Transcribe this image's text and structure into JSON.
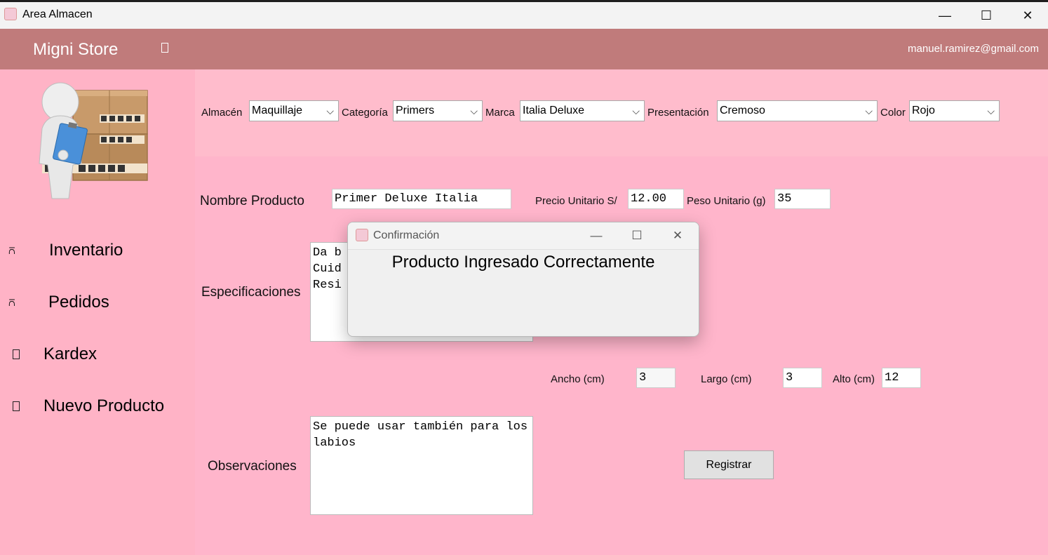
{
  "window": {
    "title": "Area Almacen",
    "minimize": "—",
    "maximize": "☐",
    "close": "✕"
  },
  "header": {
    "brand": "Migni Store",
    "user_email": "manuel.ramirez@gmail.com"
  },
  "sidebar": {
    "items": [
      {
        "label": "Inventario",
        "icon": "warehouse-icon"
      },
      {
        "label": "Pedidos",
        "icon": "warehouse-icon"
      },
      {
        "label": "Kardex",
        "icon": "box-icon"
      },
      {
        "label": "Nuevo Producto",
        "icon": "box-icon"
      }
    ]
  },
  "filters": {
    "almacen": {
      "label": "Almacén",
      "value": "Maquillaje"
    },
    "categoria": {
      "label": "Categoría",
      "value": "Primers"
    },
    "marca": {
      "label": "Marca",
      "value": "Italia Deluxe"
    },
    "presentacion": {
      "label": "Presentación",
      "value": "Cremoso"
    },
    "color": {
      "label": "Color",
      "value": "Rojo"
    }
  },
  "form": {
    "nombre_label": "Nombre Producto",
    "nombre_value": "Primer Deluxe Italia",
    "precio_label": "Precio Unitario S/",
    "precio_value": "12.00",
    "peso_label": "Peso Unitario (g)",
    "peso_value": "35",
    "especificaciones_label": "Especificaciones",
    "especificaciones_value": "Da b\nCuid\nResi",
    "ancho_label": "Ancho (cm)",
    "ancho_value": "3",
    "largo_label": "Largo (cm)",
    "largo_value": "3",
    "alto_label": "Alto (cm)",
    "alto_value": "12",
    "observaciones_label": "Observaciones",
    "observaciones_value": "Se puede usar también para los labios",
    "registrar_label": "Registrar"
  },
  "dialog": {
    "title": "Confirmación",
    "message": "Producto Ingresado Correctamente",
    "minimize": "—",
    "maximize": "☐",
    "close": "✕"
  },
  "colors": {
    "header": "#c07b7b",
    "sidebar": "#ffb3c6",
    "filters": "#ffbccc",
    "form": "#ffb5cb"
  }
}
